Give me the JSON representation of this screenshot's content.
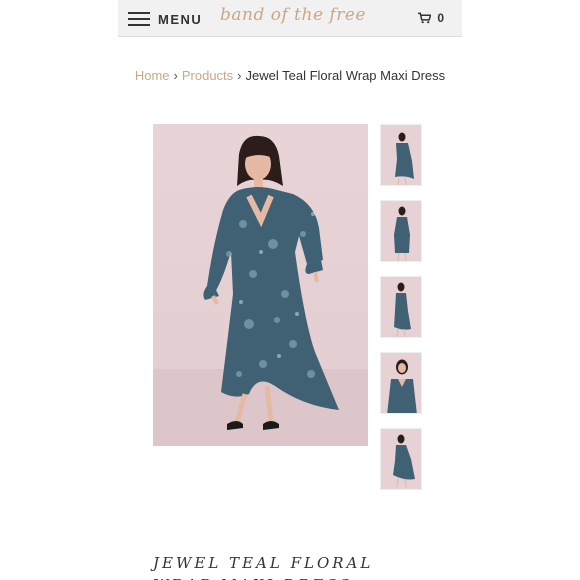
{
  "header": {
    "menu_label": "MENU",
    "logo_text": "band of the free",
    "cart_count": "0",
    "colors": {
      "background": "#f1f1f1",
      "logo": "#c9a787"
    },
    "icons": {
      "menu": "hamburger-icon",
      "cart": "cart-icon"
    }
  },
  "breadcrumb": {
    "home": "Home",
    "products": "Products",
    "separator": "›",
    "current": "Jewel Teal Floral Wrap Maxi Dress",
    "link_color": "#c9a787"
  },
  "product": {
    "title": "JEWEL TEAL FLORAL WRAP MAXI DRESS",
    "dress_color": "#3f6173",
    "backdrop_color": "#e6d2d5"
  }
}
